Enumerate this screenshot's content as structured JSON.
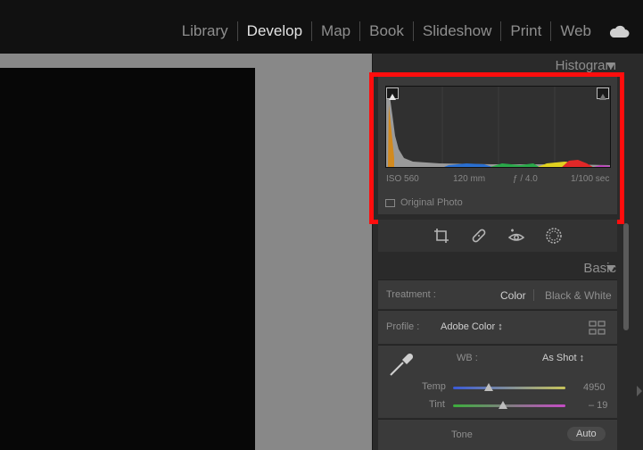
{
  "modules": [
    {
      "label": "Library",
      "active": false
    },
    {
      "label": "Develop",
      "active": true
    },
    {
      "label": "Map",
      "active": false
    },
    {
      "label": "Book",
      "active": false
    },
    {
      "label": "Slideshow",
      "active": false
    },
    {
      "label": "Print",
      "active": false
    },
    {
      "label": "Web",
      "active": false
    }
  ],
  "cloud_icon": "cloud-icon",
  "histogram": {
    "title": "Histogram",
    "iso": "ISO 560",
    "focal_length": "120 mm",
    "aperture": "ƒ / 4.0",
    "shutter": "1/100 sec",
    "original_photo_label": "Original Photo"
  },
  "tools": [
    "crop-icon",
    "healing-icon",
    "red-eye-icon",
    "mask-icon"
  ],
  "basic": {
    "title": "Basic",
    "treatment_label": "Treatment :",
    "treatment_color": "Color",
    "treatment_bw": "Black & White",
    "profile_label": "Profile :",
    "profile_value": "Adobe Color ↕",
    "wb_label": "WB :",
    "wb_value": "As Shot ↕",
    "temp_label": "Temp",
    "temp_value": "4950",
    "tint_label": "Tint",
    "tint_value": "– 19",
    "tone_label": "Tone",
    "auto_label": "Auto"
  },
  "colors": {
    "highlight_border": "#ff0d0d",
    "active_module": "#e3e3e3",
    "inactive_module": "#8e8e8e"
  }
}
